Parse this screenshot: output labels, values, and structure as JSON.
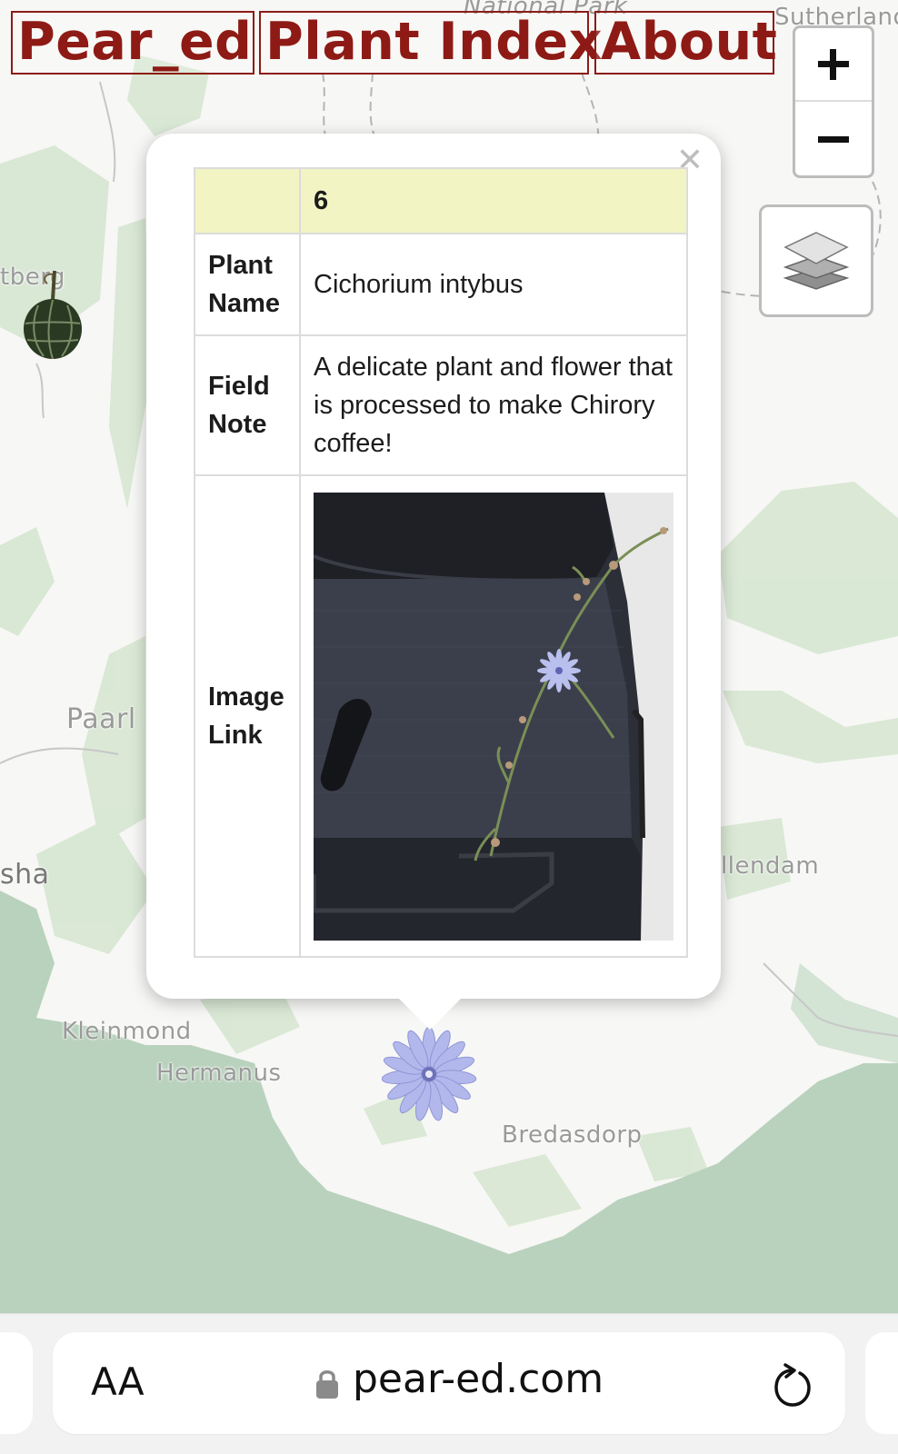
{
  "nav": {
    "brand": "Pear_ed",
    "plant_index": "Plant Index",
    "about": "About"
  },
  "map": {
    "places": {
      "national_park": "National Park",
      "sutherland": "Sutherland",
      "tberg": "tberg",
      "paarl": "Paarl",
      "sha": "sha",
      "llendam": "llendam",
      "kleinmond": "Kleinmond",
      "hermanus": "Hermanus",
      "bredasdorp": "Bredasdorp"
    },
    "colors": {
      "land": "#f7f7f5",
      "green": "#d6e6d2",
      "sea": "#b7d1bb",
      "border": "#a9a9a9"
    }
  },
  "controls": {
    "zoom_in_icon": "plus-icon",
    "zoom_out_icon": "minus-icon",
    "layers_icon": "layers-icon"
  },
  "popup": {
    "close_icon": "close-icon",
    "id": "6",
    "rows": [
      {
        "label": "Plant Name",
        "value": "Cichorium intybus"
      },
      {
        "label": "Field Note",
        "value": "A delicate plant and flower that is processed to make Chirory coffee!"
      },
      {
        "label": "Image Link",
        "value": ""
      }
    ]
  },
  "browser": {
    "text_size": "AA",
    "url": "pear-ed.com",
    "lock_icon": "lock-icon",
    "reload_icon": "reload-icon"
  }
}
